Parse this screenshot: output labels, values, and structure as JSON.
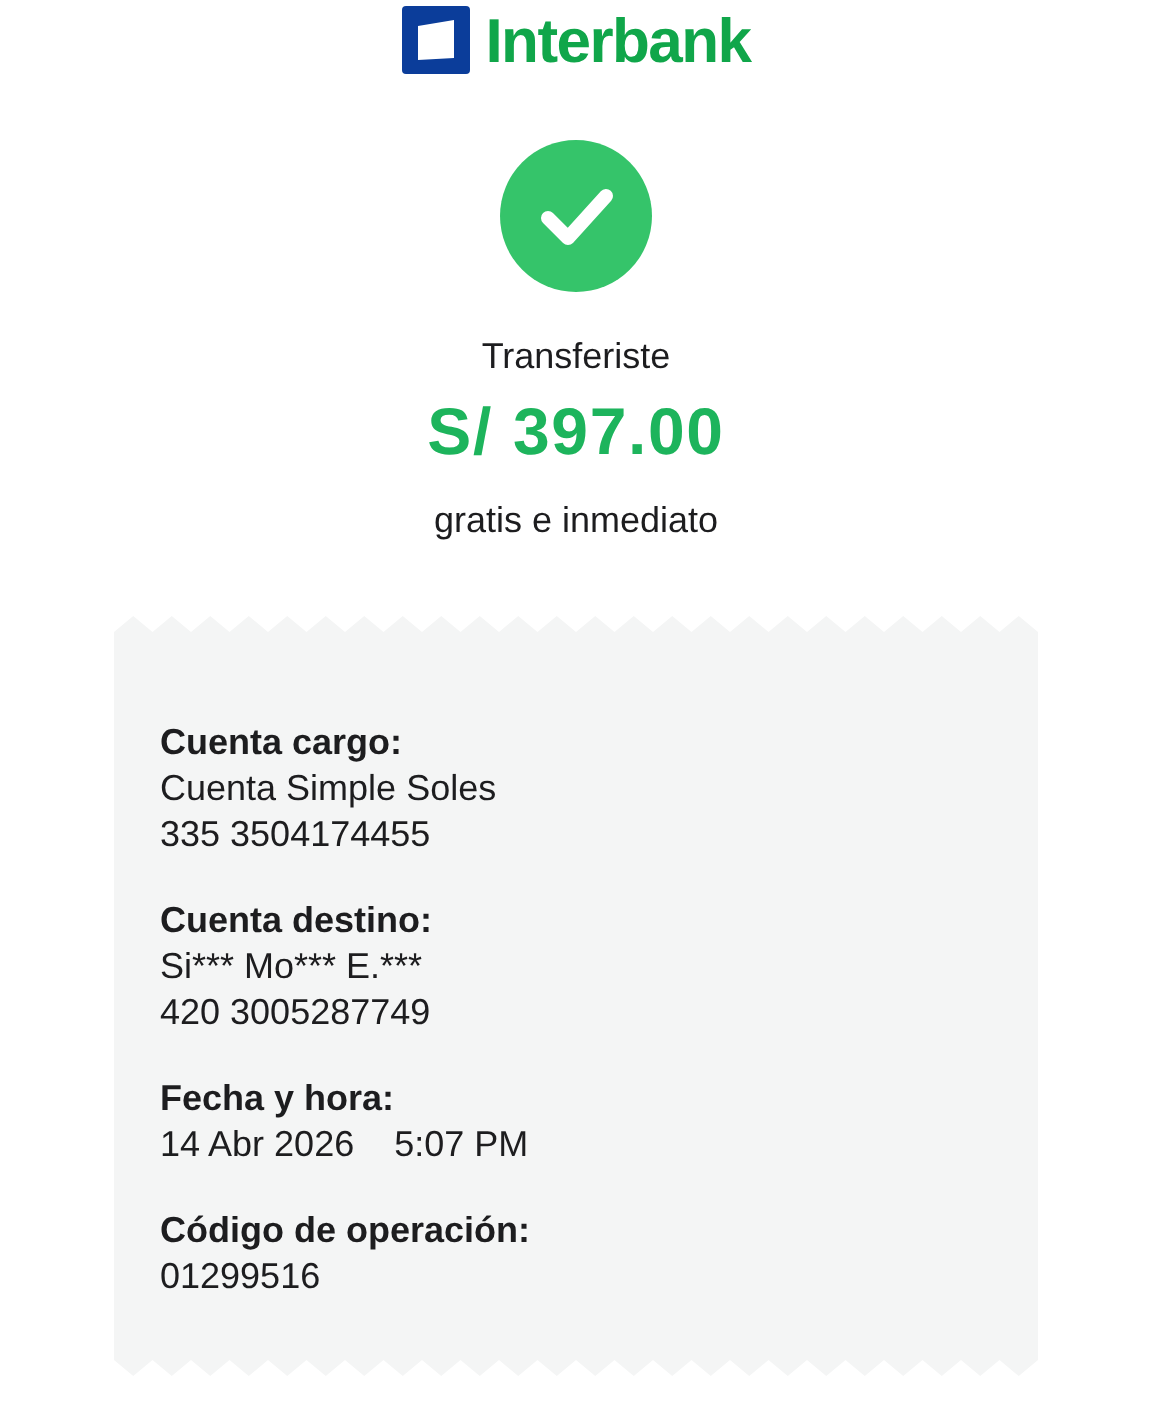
{
  "logo": {
    "text": "Interbank"
  },
  "status": {
    "title": "Transferiste",
    "amount": "S/ 397.00",
    "note": "gratis e inmediato"
  },
  "receipt": {
    "fields": [
      {
        "label": "Cuenta cargo:",
        "lines": [
          [
            "Cuenta Simple Soles"
          ],
          [
            "335 3504174455"
          ]
        ]
      },
      {
        "label": "Cuenta destino:",
        "lines": [
          [
            "Si*** Mo*** E.***"
          ],
          [
            "420 3005287749"
          ]
        ]
      },
      {
        "label": "Fecha y hora:",
        "lines": [
          [
            "14 Abr 2026",
            "5:07 PM"
          ]
        ]
      },
      {
        "label": "Código de operación:",
        "lines": [
          [
            "01299516"
          ]
        ]
      }
    ]
  }
}
